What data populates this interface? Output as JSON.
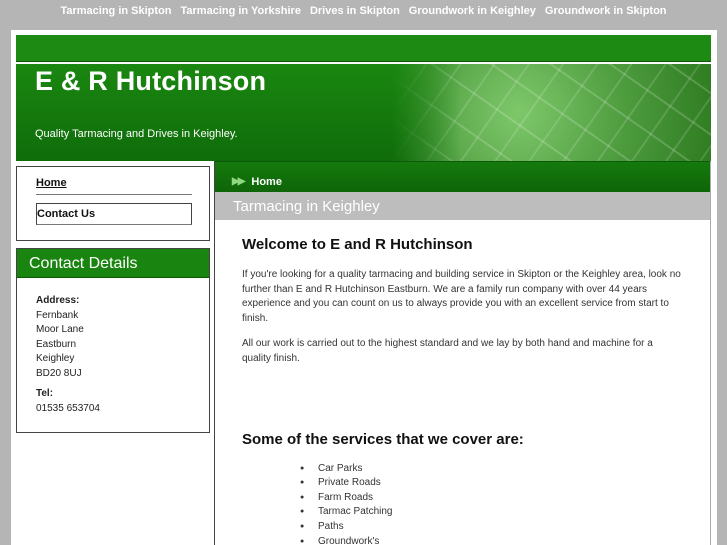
{
  "top_nav": [
    "Tarmacing in Skipton",
    "Tarmacing in Yorkshire",
    "Drives in Skipton",
    "Groundwork in Keighley",
    "Groundwork in Skipton"
  ],
  "header": {
    "title": "E & R Hutchinson",
    "tagline": "Quality Tarmacing and Drives in Keighley."
  },
  "sidebar": {
    "nav": [
      "Home",
      "Contact Us"
    ],
    "contact": {
      "heading": "Contact Details",
      "address_label": "Address:",
      "address_lines": [
        "Fernbank",
        "Moor Lane",
        "Eastburn",
        "Keighley",
        "BD20 8UJ"
      ],
      "tel_label": "Tel:",
      "tel": "01535 653704"
    }
  },
  "main": {
    "breadcrumb": "Home",
    "section_title": "Tarmacing in Keighley",
    "heading": "Welcome to E and R Hutchinson",
    "paragraphs": [
      "If you're looking for a quality tarmacing and building service in Skipton or the Keighley area, look no further than E and R Hutchinson Eastburn. We are a family run company with over 44 years experience and you can count on us to always provide you with an excellent service from start to finish.",
      "All our work is carried out to the highest standard and we lay by both hand and machine for a quality finish."
    ],
    "services_heading": "Some of the services that we cover are:",
    "services": [
      "Car Parks",
      "Private Roads",
      "Farm Roads",
      "Tarmac Patching",
      "Paths",
      "Groundwork's"
    ]
  },
  "colors": {
    "brand_green": "#1a8410",
    "page_background": "#b5b5b5",
    "section_bar": "#bdbdbd"
  }
}
